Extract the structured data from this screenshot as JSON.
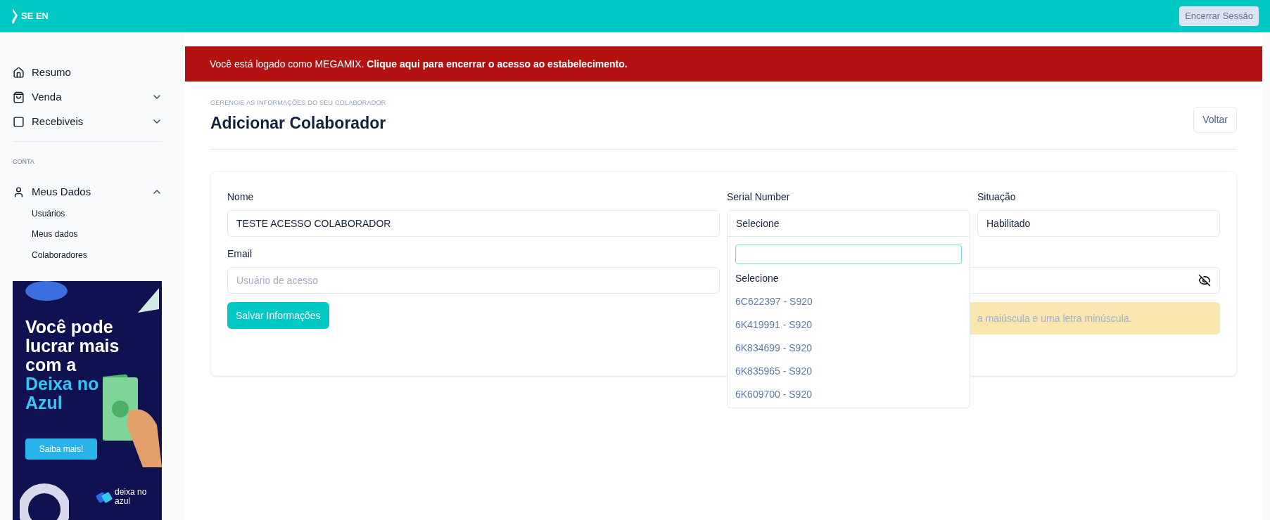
{
  "topbar": {
    "logo": "SE EN",
    "logout_button": "Encerrar Sessão"
  },
  "sidebar": {
    "items": [
      {
        "label": "Resumo"
      },
      {
        "label": "Venda",
        "expanded": false
      },
      {
        "label": "Recebiveis",
        "expanded": false
      }
    ],
    "section": "CONTA",
    "account": {
      "label": "Meus Dados",
      "expanded": true,
      "children": [
        {
          "label": "Usuários"
        },
        {
          "label": "Meus dados"
        },
        {
          "label": "Colaboradores"
        }
      ]
    },
    "ad": {
      "headline": "Você pode lucrar mais com a",
      "highlight": "Deixa no Azul",
      "button": "Saiba mais!",
      "brand": "deixa no azul"
    }
  },
  "banner": "Você está logado como MEGAMIX. **Clique aqui para encerrar o acesso ao estabelecimento.**",
  "page": {
    "subtitle": "GERENCIE AS INFORMAÇÕES DO SEU COLABORADOR",
    "title": "Adicionar Colaborador",
    "back_button": "Voltar"
  },
  "form": {
    "nome": {
      "label": "Nome",
      "value": "TESTE ACESSO COLABORADOR"
    },
    "serial": {
      "label": "Serial Number",
      "value": "Selecione",
      "expanded": true,
      "options": [
        "Selecione",
        "6C622397 - S920",
        "6K419991 - S920",
        "6K834699 - S920",
        "6K835965 - S920",
        "6K609700 - S920"
      ]
    },
    "situacao": {
      "label": "Situação",
      "value": "Habilitado"
    },
    "email": {
      "label": "Email",
      "placeholder": "Usuário de acesso"
    },
    "password_hint": "a maiúscula e uma letra minúscula.",
    "save_button": "Salvar Informações"
  }
}
